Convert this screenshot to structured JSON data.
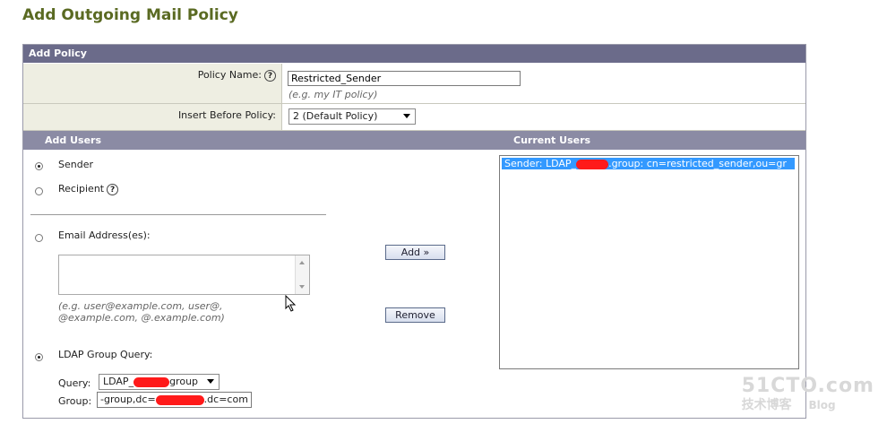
{
  "page": {
    "title": "Add Outgoing Mail Policy"
  },
  "policy": {
    "section_title": "Add Policy",
    "name_label": "Policy Name:",
    "name_value": "Restricted_Sender",
    "name_hint": "(e.g. my IT policy)",
    "insert_label": "Insert Before Policy:",
    "insert_value": "2 (Default Policy)"
  },
  "users": {
    "add_header": "Add Users",
    "current_header": "Current Users",
    "sender_label": "Sender",
    "recipient_label": "Recipient",
    "email_label": "Email Address(es):",
    "email_hint": "(e.g. user@example.com, user@, @example.com, @.example.com)",
    "ldap_label": "LDAP Group Query:",
    "query_label": "Query:",
    "query_value_prefix": "LDAP_",
    "query_value_suffix": "group",
    "group_label": "Group:",
    "group_value_prefix": "-group,dc=",
    "group_value_suffix": ".dc=com",
    "add_button": "Add »",
    "remove_button": "Remove",
    "current_items": [
      {
        "prefix": "Sender: LDAP_",
        "suffix": ".group: cn=restricted_sender,ou=gr"
      }
    ]
  },
  "watermark": {
    "site": "51CTO.com",
    "sub": "技术博客",
    "blog": "Blog"
  }
}
